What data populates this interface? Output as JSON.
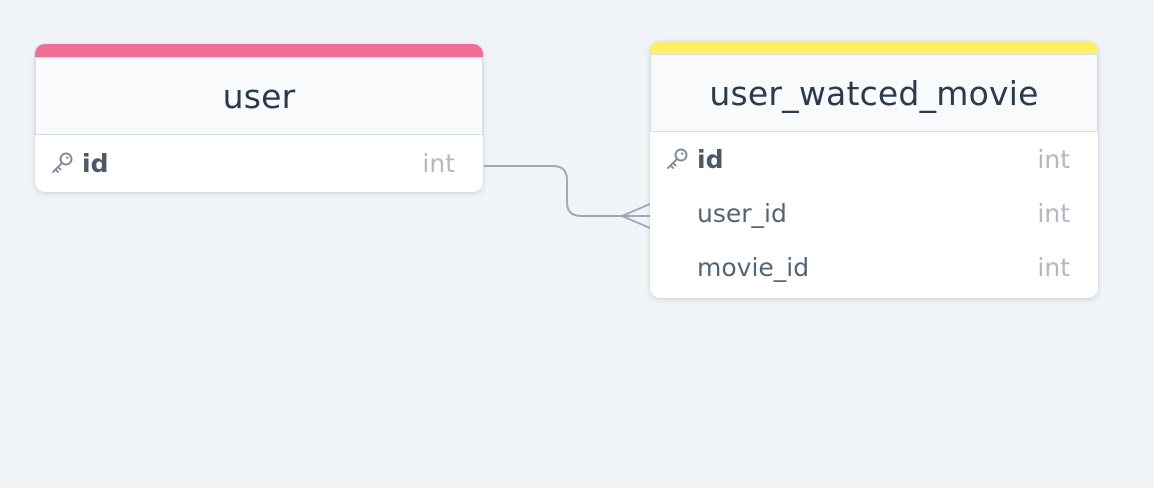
{
  "tables": {
    "user": {
      "title": "user",
      "accent_color": "#f06d96",
      "fields": [
        {
          "name": "id",
          "type": "int",
          "primary_key": true,
          "icon": "key-icon"
        }
      ]
    },
    "user_watced_movie": {
      "title": "user_watced_movie",
      "accent_color": "#ffee66",
      "fields": [
        {
          "name": "id",
          "type": "int",
          "primary_key": true,
          "icon": "key-icon"
        },
        {
          "name": "user_id",
          "type": "int",
          "primary_key": false
        },
        {
          "name": "movie_id",
          "type": "int",
          "primary_key": false
        }
      ]
    }
  },
  "relationships": [
    {
      "from": "user.id",
      "to": "user_watced_movie.user_id",
      "cardinality": "one-to-many",
      "line_color": "#9eaab8"
    }
  ]
}
